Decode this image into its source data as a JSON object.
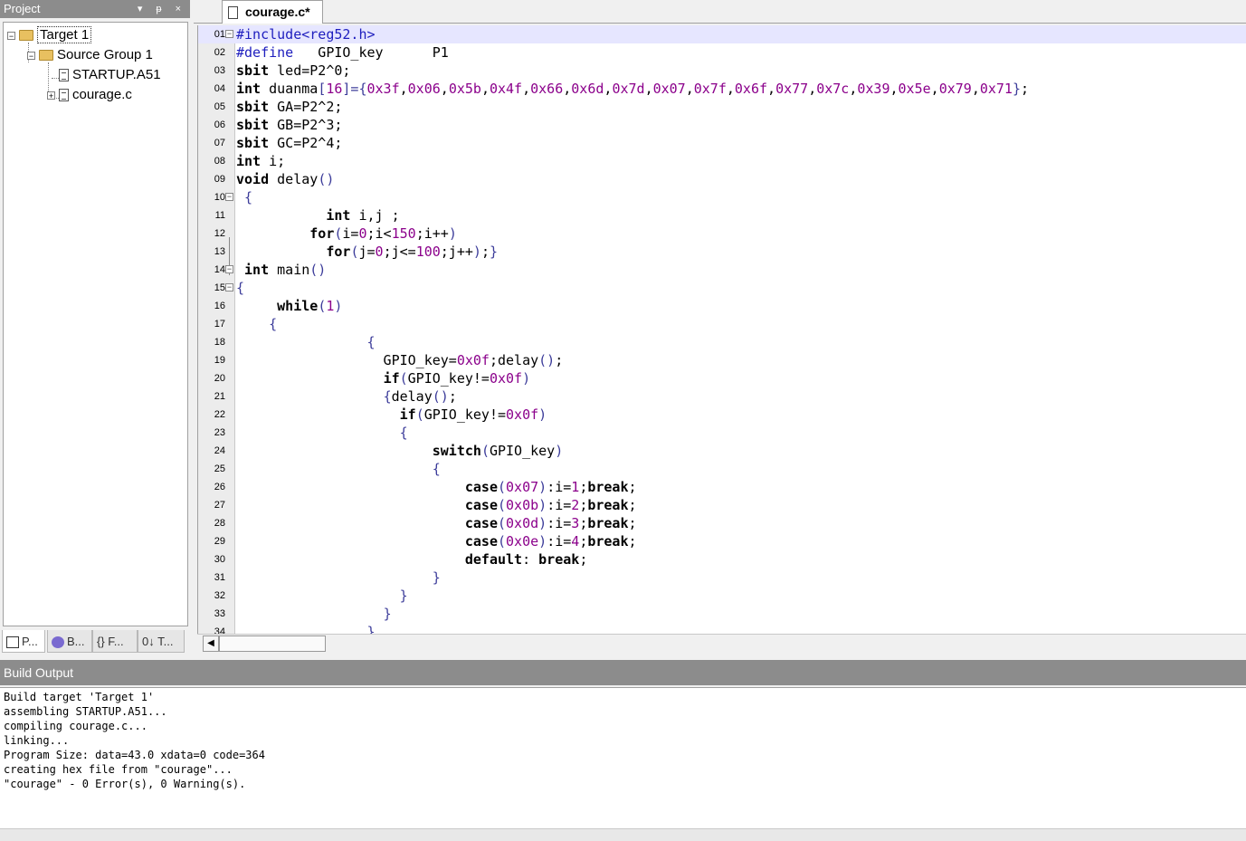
{
  "project": {
    "title": "Project",
    "controls": "▾ ᵽ ×",
    "tree": [
      {
        "label": "Target 1",
        "level": 0,
        "kind": "folder",
        "expander": "−"
      },
      {
        "label": "Source Group 1",
        "level": 1,
        "kind": "folder",
        "expander": "−"
      },
      {
        "label": "STARTUP.A51",
        "level": 2,
        "kind": "file",
        "expander": ""
      },
      {
        "label": "courage.c",
        "level": 2,
        "kind": "file",
        "expander": "+"
      }
    ],
    "tabs": [
      "P...",
      "B...",
      "{} F...",
      "0↓ T..."
    ]
  },
  "editor": {
    "tab_label": "courage.c*",
    "lines": [
      {
        "n": "01",
        "fold": "−",
        "html": "<span class='pp'>#include&lt;reg52.h&gt;</span>"
      },
      {
        "n": "02",
        "fold": "",
        "html": "<span class='pp'>#define</span>   GPIO_key      P1"
      },
      {
        "n": "03",
        "fold": "",
        "html": "<span class='kw'>sbit</span> led=P2^0;"
      },
      {
        "n": "04",
        "fold": "",
        "html": "<span class='kw'>int</span> duanma<span class='op'>[</span><span class='num'>16</span><span class='op'>]={</span><span class='num'>0x3f</span>,<span class='num'>0x06</span>,<span class='num'>0x5b</span>,<span class='num'>0x4f</span>,<span class='num'>0x66</span>,<span class='num'>0x6d</span>,<span class='num'>0x7d</span>,<span class='num'>0x07</span>,<span class='num'>0x7f</span>,<span class='num'>0x6f</span>,<span class='num'>0x77</span>,<span class='num'>0x7c</span>,<span class='num'>0x39</span>,<span class='num'>0x5e</span>,<span class='num'>0x79</span>,<span class='num'>0x71</span><span class='op'>}</span>;"
      },
      {
        "n": "05",
        "fold": "",
        "html": "<span class='kw'>sbit</span> GA=P2^2;"
      },
      {
        "n": "06",
        "fold": "",
        "html": "<span class='kw'>sbit</span> GB=P2^3;"
      },
      {
        "n": "07",
        "fold": "",
        "html": "<span class='kw'>sbit</span> GC=P2^4;"
      },
      {
        "n": "08",
        "fold": "",
        "html": "<span class='kw'>int</span> i;"
      },
      {
        "n": "09",
        "fold": "",
        "html": "<span class='kw'>void</span> delay<span class='op'>()</span>"
      },
      {
        "n": "10",
        "fold": "−",
        "html": " <span class='op'>{</span>"
      },
      {
        "n": "11",
        "fold": "",
        "html": "           <span class='kw'>int</span> i,j ;"
      },
      {
        "n": "12",
        "fold": "",
        "html": "         <span class='kw'>for</span><span class='op'>(</span>i=<span class='num'>0</span>;i&lt;<span class='num'>150</span>;i++<span class='op'>)</span>"
      },
      {
        "n": "13",
        "fold": "",
        "html": "           <span class='kw'>for</span><span class='op'>(</span>j=<span class='num'>0</span>;j&lt;=<span class='num'>100</span>;j++<span class='op'>)</span>;<span class='op'>}</span>"
      },
      {
        "n": "14",
        "fold": "−",
        "html": " <span class='kw'>int</span> main<span class='op'>()</span>"
      },
      {
        "n": "15",
        "fold": "−",
        "html": "<span class='op'>{</span>"
      },
      {
        "n": "16",
        "fold": "",
        "html": "     <span class='kw'>while</span><span class='op'>(</span><span class='num'>1</span><span class='op'>)</span>"
      },
      {
        "n": "17",
        "fold": "",
        "html": "    <span class='op'>{</span>"
      },
      {
        "n": "18",
        "fold": "",
        "html": "                <span class='op'>{</span>"
      },
      {
        "n": "19",
        "fold": "",
        "html": "                  GPIO_key=<span class='num'>0x0f</span>;delay<span class='op'>()</span>;"
      },
      {
        "n": "20",
        "fold": "",
        "html": "                  <span class='kw'>if</span><span class='op'>(</span>GPIO_key!=<span class='num'>0x0f</span><span class='op'>)</span>"
      },
      {
        "n": "21",
        "fold": "",
        "html": "                  <span class='op'>{</span>delay<span class='op'>()</span>;"
      },
      {
        "n": "22",
        "fold": "",
        "html": "                    <span class='kw'>if</span><span class='op'>(</span>GPIO_key!=<span class='num'>0x0f</span><span class='op'>)</span>"
      },
      {
        "n": "23",
        "fold": "",
        "html": "                    <span class='op'>{</span>"
      },
      {
        "n": "24",
        "fold": "",
        "html": "                        <span class='kw'>switch</span><span class='op'>(</span>GPIO_key<span class='op'>)</span>"
      },
      {
        "n": "25",
        "fold": "",
        "html": "                        <span class='op'>{</span>"
      },
      {
        "n": "26",
        "fold": "",
        "html": "                            <span class='kw'>case</span><span class='op'>(</span><span class='num'>0x07</span><span class='op'>)</span>:i=<span class='num'>1</span>;<span class='kw'>break</span>;"
      },
      {
        "n": "27",
        "fold": "",
        "html": "                            <span class='kw'>case</span><span class='op'>(</span><span class='num'>0x0b</span><span class='op'>)</span>:i=<span class='num'>2</span>;<span class='kw'>break</span>;"
      },
      {
        "n": "28",
        "fold": "",
        "html": "                            <span class='kw'>case</span><span class='op'>(</span><span class='num'>0x0d</span><span class='op'>)</span>:i=<span class='num'>3</span>;<span class='kw'>break</span>;"
      },
      {
        "n": "29",
        "fold": "",
        "html": "                            <span class='kw'>case</span><span class='op'>(</span><span class='num'>0x0e</span><span class='op'>)</span>:i=<span class='num'>4</span>;<span class='kw'>break</span>;"
      },
      {
        "n": "30",
        "fold": "",
        "html": "                            <span class='kw'>default</span>: <span class='kw'>break</span>;"
      },
      {
        "n": "31",
        "fold": "",
        "html": "                        <span class='op'>}</span>"
      },
      {
        "n": "32",
        "fold": "",
        "html": "                    <span class='op'>}</span>"
      },
      {
        "n": "33",
        "fold": "",
        "html": "                  <span class='op'>}</span>"
      },
      {
        "n": "34",
        "fold": "",
        "html": "                <span class='op'>}</span>"
      }
    ]
  },
  "build": {
    "title": "Build Output",
    "lines": [
      "Build target 'Target 1'",
      "assembling STARTUP.A51...",
      "compiling courage.c...",
      "linking...",
      "Program Size: data=43.0 xdata=0 code=364",
      "creating hex file from \"courage\"...",
      "\"courage\" - 0 Error(s), 0 Warning(s)."
    ]
  },
  "colors": {
    "panel_header": "#8c8c8c",
    "current_line": "#e6e6ff",
    "preprocessor": "#1e1ebe",
    "number": "#8b008b"
  }
}
